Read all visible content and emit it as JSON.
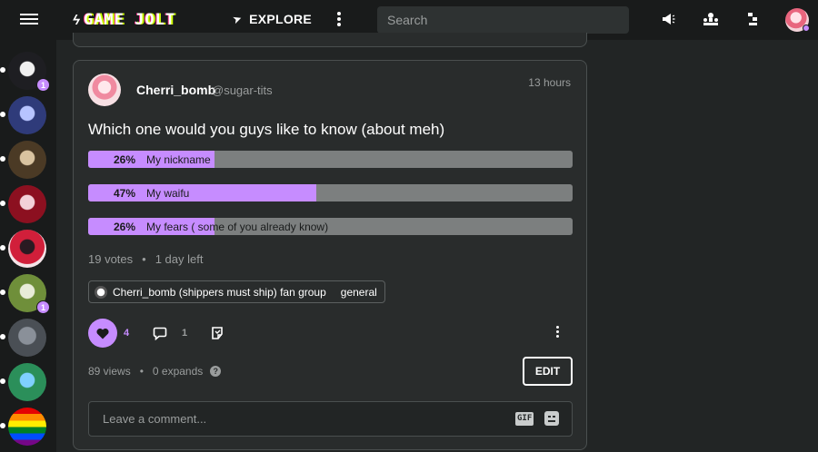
{
  "app": {
    "logo_text": "GAME JOLT",
    "explore_label": "EXPLORE",
    "search_placeholder": "Search",
    "accent_color": "#c68cff"
  },
  "topbar": {
    "icons": [
      "menu-icon",
      "megaphone-icon",
      "trophy-icon",
      "notifications-icon"
    ]
  },
  "sidebar": {
    "items": [
      {
        "name": "community-1",
        "badge": "1",
        "colors": [
          "#1e1e22",
          "#f0f0f0"
        ]
      },
      {
        "name": "community-2",
        "badge": "",
        "colors": [
          "#2f3b7a",
          "#b7c4ff"
        ]
      },
      {
        "name": "community-3",
        "badge": "",
        "colors": [
          "#4b3a25",
          "#d9c3a0"
        ]
      },
      {
        "name": "community-4",
        "badge": "",
        "colors": [
          "#8c1020",
          "#f2d1d8"
        ]
      },
      {
        "name": "community-5",
        "badge": "",
        "colors": [
          "#d11f3a",
          "#2a1a22"
        ]
      },
      {
        "name": "community-6",
        "badge": "1",
        "colors": [
          "#6f8f3a",
          "#e8ecd8"
        ]
      },
      {
        "name": "community-7",
        "badge": "",
        "colors": [
          "#4a4f55",
          "#8a9099"
        ]
      },
      {
        "name": "community-8",
        "badge": "",
        "colors": [
          "#2b8f5a",
          "#7fd0ff"
        ]
      },
      {
        "name": "community-9",
        "badge": "",
        "colors": [
          "rainbow"
        ]
      }
    ]
  },
  "post": {
    "author_name": "Cherri_bomb",
    "author_handle": "@sugar-tits",
    "time": "13 hours",
    "title": "Which one would you guys like to know (about meh)",
    "poll": [
      {
        "percent_label": "26%",
        "label": "My nickname",
        "fraction": 0.26
      },
      {
        "percent_label": "47%",
        "label": "My waifu",
        "fraction": 0.47
      },
      {
        "percent_label": "26%",
        "label": "My fears ( some of you already know)",
        "fraction": 0.26
      }
    ],
    "votes": "19 votes",
    "time_left": "1 day left",
    "community": "Cherri_bomb (shippers must ship) fan group",
    "channel": "general",
    "like_count": "4",
    "comment_count": "1",
    "views": "89 views",
    "expands": "0 expands",
    "help": "?",
    "edit_label": "EDIT",
    "comment_placeholder": "Leave a comment...",
    "gif_label": "GIF"
  }
}
